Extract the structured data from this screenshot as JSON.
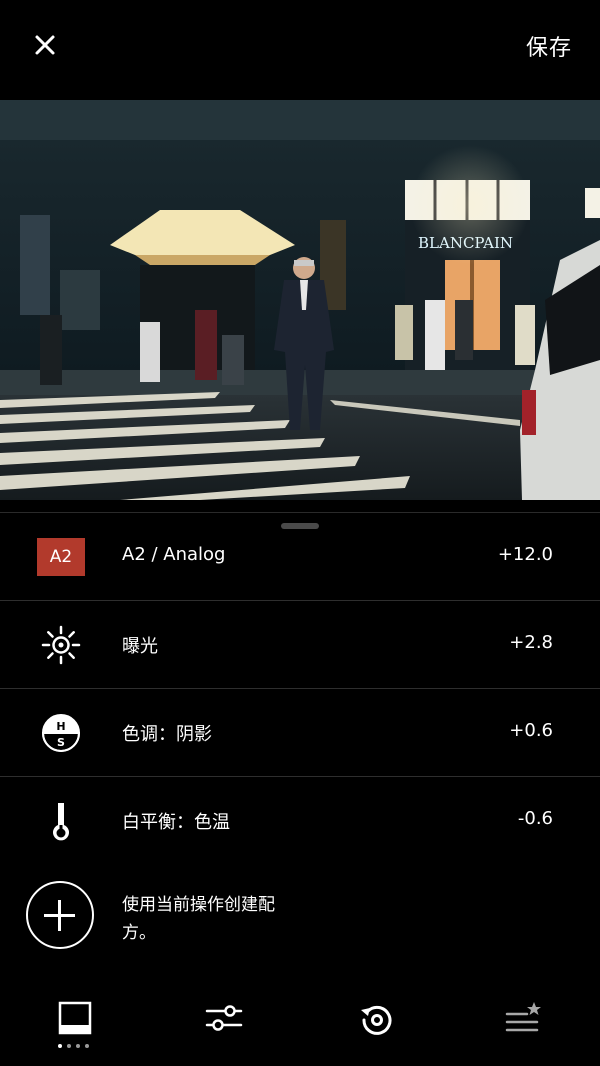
{
  "header": {
    "close_icon": "close-icon",
    "save_label": "保存"
  },
  "photo": {
    "description_icon": "photo-preview",
    "sign_text": "BLANCPAIN"
  },
  "adjustments": [
    {
      "id": "preset",
      "badge": "A2",
      "label": "A2 / Analog",
      "value": "+12.0",
      "icon": "preset-badge",
      "badge_color": "#b23a2c"
    },
    {
      "id": "exposure",
      "label": "曝光",
      "value": "+2.8",
      "icon": "sun-icon"
    },
    {
      "id": "tone",
      "label": "色调：阴影",
      "value": "+0.6",
      "icon": "highlights-shadows-icon"
    },
    {
      "id": "wb",
      "label": "白平衡：色温",
      "value": "-0.6",
      "icon": "thermometer-icon"
    }
  ],
  "recipe": {
    "text": "使用当前操作创建配方。",
    "icon": "add-circle-icon"
  },
  "tabs": [
    {
      "name": "presets",
      "icon": "presets-icon",
      "active": true
    },
    {
      "name": "tools",
      "icon": "sliders-icon",
      "active": false
    },
    {
      "name": "history",
      "icon": "history-icon",
      "active": false
    },
    {
      "name": "recipes",
      "icon": "recipes-star-icon",
      "active": false
    }
  ]
}
